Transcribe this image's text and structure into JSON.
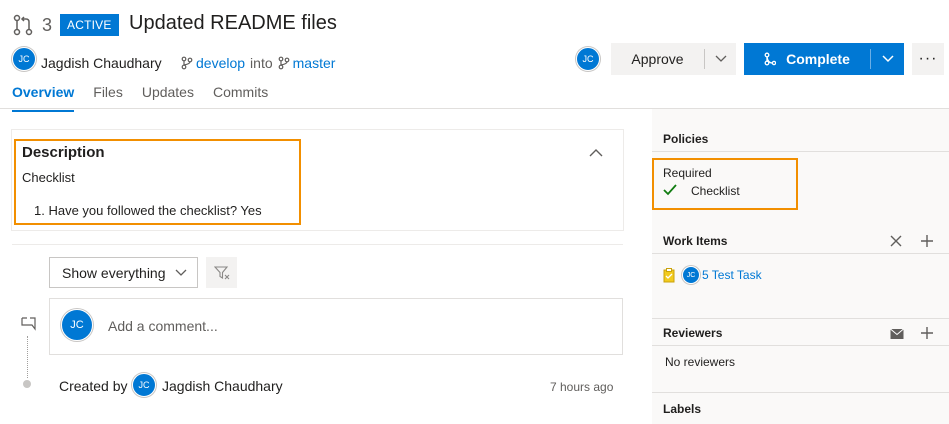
{
  "header": {
    "pr_id": "3",
    "status_badge": "ACTIVE",
    "title": "Updated README files",
    "author_initials": "JC",
    "author_name": "Jagdish Chaudhary",
    "source_branch": "develop",
    "into_text": "into",
    "target_branch": "master"
  },
  "tabs": [
    {
      "label": "Overview",
      "active": true
    },
    {
      "label": "Files",
      "active": false
    },
    {
      "label": "Updates",
      "active": false
    },
    {
      "label": "Commits",
      "active": false
    }
  ],
  "actions": {
    "reviewer_initials": "JC",
    "approve_label": "Approve",
    "complete_label": "Complete",
    "more_label": "···"
  },
  "description": {
    "heading": "Description",
    "subheading": "Checklist",
    "item": "1. Have you followed the checklist? Yes"
  },
  "activity": {
    "filter_label": "Show everything",
    "comment_avatar_initials": "JC",
    "comment_placeholder": "Add a comment...",
    "created_by_label": "Created by",
    "creator_initials": "JC",
    "creator_name": "Jagdish Chaudhary",
    "created_time": "7 hours ago"
  },
  "sidebar": {
    "policies_heading": "Policies",
    "required_label": "Required",
    "policy_item": "Checklist",
    "work_items_heading": "Work Items",
    "work_item_avatar": "JC",
    "work_item_label": "5 Test Task",
    "reviewers_heading": "Reviewers",
    "no_reviewers": "No reviewers",
    "labels_heading": "Labels"
  },
  "colors": {
    "accent": "#0078d4",
    "highlight": "#f28f00",
    "success": "#107c10"
  },
  "icons": [
    "pull-request-icon",
    "branch-icon",
    "chevron-down-icon",
    "merge-icon",
    "chevron-up-icon",
    "filter-icon",
    "comment-icon",
    "check-icon",
    "close-icon",
    "plus-icon",
    "task-icon",
    "mail-icon"
  ]
}
